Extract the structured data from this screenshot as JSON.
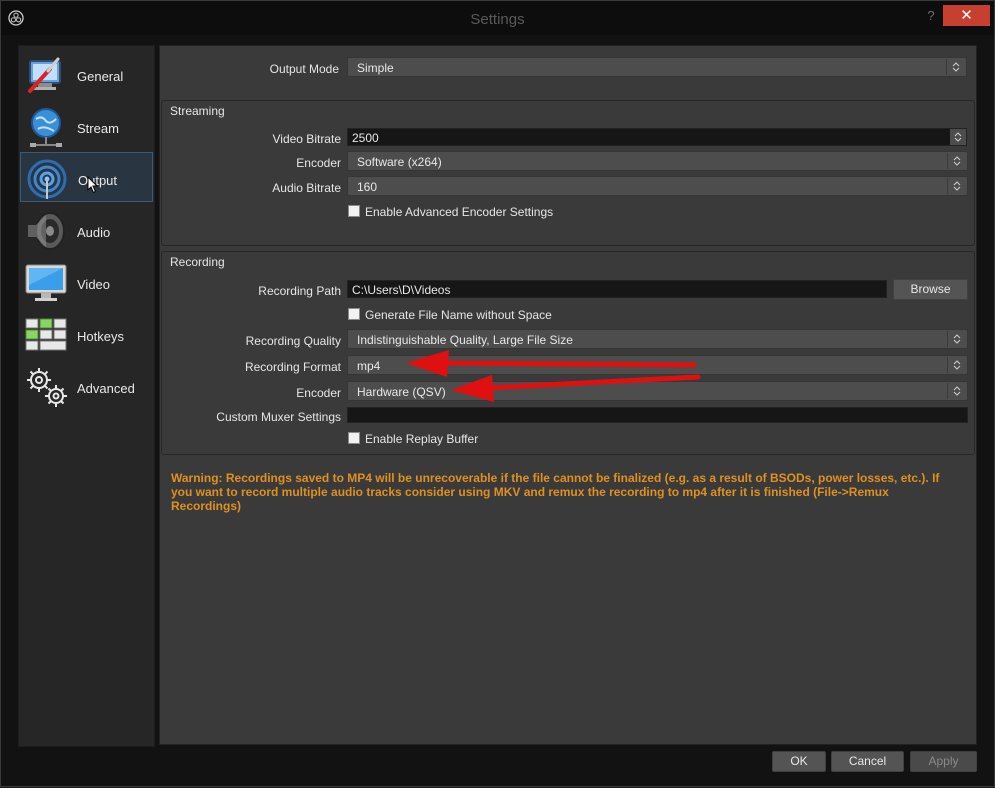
{
  "window": {
    "title": "Settings",
    "help_label": "?",
    "close_label": "✕"
  },
  "sidebar": {
    "items": [
      {
        "label": "General",
        "icon": "general-icon"
      },
      {
        "label": "Stream",
        "icon": "stream-globe-icon"
      },
      {
        "label": "Output",
        "icon": "output-antenna-icon",
        "active": true
      },
      {
        "label": "Audio",
        "icon": "speaker-icon"
      },
      {
        "label": "Video",
        "icon": "monitor-icon"
      },
      {
        "label": "Hotkeys",
        "icon": "keyboard-icon"
      },
      {
        "label": "Advanced",
        "icon": "gears-icon"
      }
    ]
  },
  "output_mode": {
    "label": "Output Mode",
    "value": "Simple"
  },
  "streaming": {
    "title": "Streaming",
    "video_bitrate_label": "Video Bitrate",
    "video_bitrate_value": "2500",
    "encoder_label": "Encoder",
    "encoder_value": "Software (x264)",
    "audio_bitrate_label": "Audio Bitrate",
    "audio_bitrate_value": "160",
    "advanced_encoder_label": "Enable Advanced Encoder Settings"
  },
  "recording": {
    "title": "Recording",
    "path_label": "Recording Path",
    "path_value": "C:\\Users\\D\\Videos",
    "browse_label": "Browse",
    "gen_filename_label": "Generate File Name without Space",
    "quality_label": "Recording Quality",
    "quality_value": "Indistinguishable Quality, Large File Size",
    "format_label": "Recording Format",
    "format_value": "mp4",
    "encoder_label": "Encoder",
    "encoder_value": "Hardware (QSV)",
    "muxer_label": "Custom Muxer Settings",
    "muxer_value": "",
    "replay_label": "Enable Replay Buffer"
  },
  "warning": "Warning: Recordings saved to MP4 will be unrecoverable if the file cannot be finalized (e.g. as a result of BSODs, power losses, etc.). If you want to record multiple audio tracks consider using MKV and remux the recording to mp4 after it is finished (File->Remux Recordings)",
  "footer": {
    "ok_label": "OK",
    "cancel_label": "Cancel",
    "apply_label": "Apply"
  },
  "colors": {
    "warning": "#e0901f",
    "annotation_arrow": "#e01010",
    "close_button": "#c7402f"
  }
}
